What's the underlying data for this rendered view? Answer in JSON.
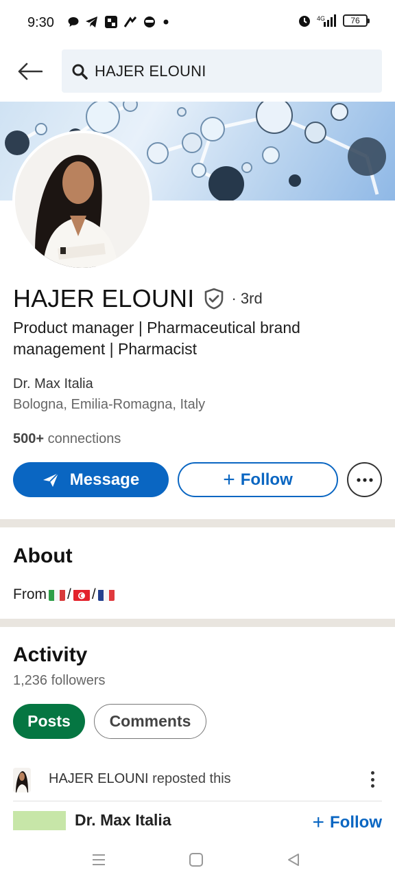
{
  "status_bar": {
    "time": "9:30",
    "battery": "76"
  },
  "search": {
    "query": "HAJER ELOUNI"
  },
  "profile": {
    "name": "HAJER ELOUNI",
    "degree": "· 3rd",
    "headline": "Product manager | Pharmaceutical brand management | Pharmacist",
    "company": "Dr. Max Italia",
    "location": "Bologna, Emilia-Romagna, Italy",
    "connections_count": "500+",
    "connections_label": "connections"
  },
  "actions": {
    "message_label": "Message",
    "follow_label": "Follow"
  },
  "about": {
    "title": "About",
    "prefix": "From",
    "sep": "/"
  },
  "activity": {
    "title": "Activity",
    "followers": "1,236 followers",
    "tabs": [
      "Posts",
      "Comments"
    ],
    "repost_name": "HAJER ELOUNI",
    "repost_suffix": "reposted this",
    "post_company": "Dr. Max Italia",
    "post_follow_label": "Follow"
  },
  "colors": {
    "brand_blue": "#0a66c2",
    "active_pill": "#057642",
    "divider": "#e9e5df"
  },
  "icons": [
    "back-arrow-icon",
    "search-icon",
    "verified-shield-icon",
    "send-icon",
    "more-icon",
    "kebab-icon",
    "menu-icon",
    "home-icon",
    "back-triangle-icon"
  ]
}
